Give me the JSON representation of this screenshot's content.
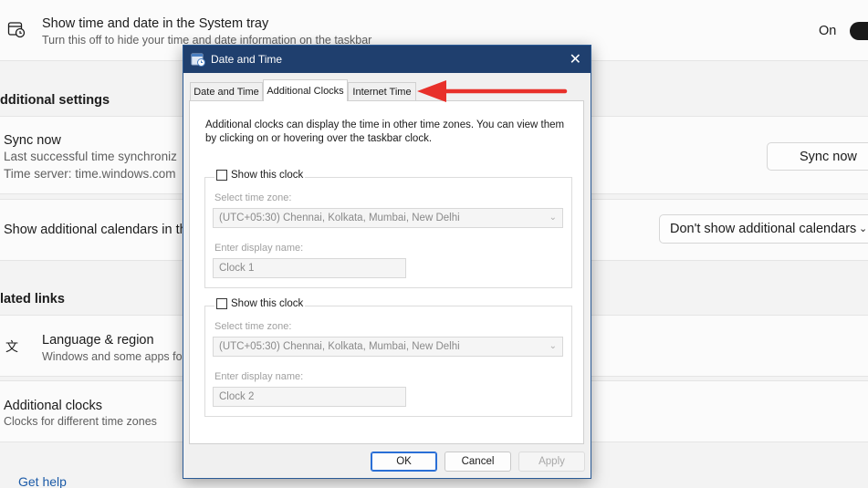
{
  "settings": {
    "tray_title": "Show time and date in the System tray",
    "tray_desc": "Turn this off to hide your time and date information on the taskbar",
    "tray_toggle_label": "On",
    "additional_settings_heading": "dditional settings",
    "sync_title": "Sync now",
    "sync_last": "Last successful time synchroniz",
    "sync_server": "Time server: time.windows.com",
    "sync_button": "Sync now",
    "calendars_title": "Show additional calendars in the",
    "calendars_select": "Don't show additional calendars",
    "related_links_heading": "lated links",
    "language_title": "Language & region",
    "language_desc": "Windows and some apps for",
    "clocks_title": "Additional clocks",
    "clocks_desc": "Clocks for different time zones",
    "get_help": "Get help"
  },
  "dialog": {
    "title": "Date and Time",
    "tabs": [
      {
        "label": "Date and Time"
      },
      {
        "label": "Additional Clocks"
      },
      {
        "label": "Internet Time"
      }
    ],
    "description": "Additional clocks can display the time in other time zones. You can view them by clicking on or hovering over the taskbar clock.",
    "clocks": [
      {
        "show_label": "Show this clock",
        "timezone_label": "Select time zone:",
        "timezone_value": "(UTC+05:30) Chennai, Kolkata, Mumbai, New Delhi",
        "display_name_label": "Enter display name:",
        "display_name_value": "Clock 1"
      },
      {
        "show_label": "Show this clock",
        "timezone_label": "Select time zone:",
        "timezone_value": "(UTC+05:30) Chennai, Kolkata, Mumbai, New Delhi",
        "display_name_label": "Enter display name:",
        "display_name_value": "Clock 2"
      }
    ],
    "buttons": {
      "ok": "OK",
      "cancel": "Cancel",
      "apply": "Apply"
    }
  },
  "colors": {
    "titlebar": "#1f3f6e",
    "arrow": "#e8302a",
    "accent_focus": "#2a6fd6"
  }
}
